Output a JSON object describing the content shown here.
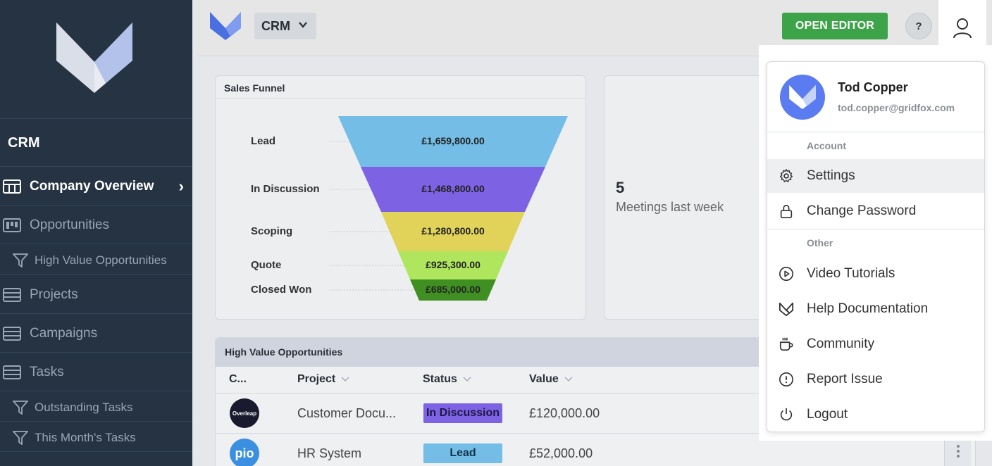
{
  "sidebar": {
    "app_name": "CRM",
    "items": [
      {
        "label": "Company Overview"
      },
      {
        "label": "Opportunities"
      },
      {
        "label": "High Value Opportunities"
      },
      {
        "label": "Projects"
      },
      {
        "label": "Campaigns"
      },
      {
        "label": "Tasks"
      },
      {
        "label": "Outstanding Tasks"
      },
      {
        "label": "This Month's Tasks"
      }
    ]
  },
  "topbar": {
    "app_select": "CRM",
    "open_editor": "OPEN EDITOR",
    "help": "?"
  },
  "funnel": {
    "title": "Sales Funnel",
    "stages": [
      {
        "label": "Lead",
        "value": "£1,659,800.00",
        "color": "#74bde6"
      },
      {
        "label": "In Discussion",
        "value": "£1,468,800.00",
        "color": "#7d63e4"
      },
      {
        "label": "Scoping",
        "value": "£1,280,800.00",
        "color": "#e1d35a"
      },
      {
        "label": "Quote",
        "value": "£925,300.00",
        "color": "#b0e55e"
      },
      {
        "label": "Closed Won",
        "value": "£685,000.00",
        "color": "#3f8f22"
      }
    ]
  },
  "stat": {
    "value": "5",
    "label": "Meetings last week"
  },
  "table": {
    "title": "High Value Opportunities",
    "columns": [
      "C...",
      "Project",
      "Status",
      "Value"
    ],
    "rows": [
      {
        "logo": "Overleap",
        "project": "Customer Docu...",
        "status": "In Discussion",
        "status_color": "#7d63e4",
        "value": "£120,000.00"
      },
      {
        "logo": "pio",
        "project": "HR System",
        "status": "Lead",
        "status_color": "#74bde6",
        "value": "£52,000.00"
      }
    ]
  },
  "user_menu": {
    "name": "Tod Copper",
    "email": "tod.copper@gridfox.com",
    "section_account": "Account",
    "section_other": "Other",
    "items": [
      {
        "label": "Settings",
        "icon": "gear-icon"
      },
      {
        "label": "Change Password",
        "icon": "lock-icon"
      },
      {
        "label": "Video Tutorials",
        "icon": "play-circle-icon"
      },
      {
        "label": "Help Documentation",
        "icon": "gridfox-icon"
      },
      {
        "label": "Community",
        "icon": "coffee-icon"
      },
      {
        "label": "Report Issue",
        "icon": "alert-circle-icon"
      },
      {
        "label": "Logout",
        "icon": "power-icon"
      }
    ]
  }
}
